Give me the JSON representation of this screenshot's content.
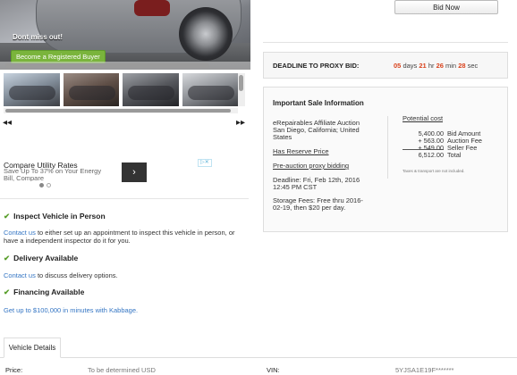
{
  "hero": {
    "headline": "Dont miss out!",
    "register_label": "Become a Registered Buyer"
  },
  "gallery": {
    "thumbnails": [
      "car-photo-1",
      "car-photo-2",
      "car-photo-3",
      "car-photo-4"
    ],
    "prev_icon": "◂◂",
    "next_icon": "▸▸"
  },
  "ad": {
    "title": "Compare Utility Rates",
    "subtitle": "Save Up To 37% on Your Energy Bill, Compare",
    "next_icon": "›",
    "close_icon": "▷✕"
  },
  "features": [
    {
      "title": "Inspect Vehicle in Person",
      "link": "Contact us",
      "text": " to either set up an appointment to inspect this vehicle in person, or have a independent inspector do it for you."
    },
    {
      "title": "Delivery Available",
      "link": "Contact us",
      "text": " to discuss delivery options."
    },
    {
      "title": "Financing Available",
      "link": "Get up to $100,000 in minutes with Kabbage.",
      "text": ""
    }
  ],
  "bid": {
    "button_label": "Bid Now"
  },
  "proxy": {
    "label": "DEADLINE TO PROXY BID:",
    "days": "05",
    "days_unit": "days",
    "hours": "21",
    "hours_unit": "hr",
    "minutes": "26",
    "minutes_unit": "min",
    "seconds": "28",
    "seconds_unit": "sec"
  },
  "info": {
    "title": "Important Sale Information",
    "seller_line1": "eRepairables Affiliate Auction",
    "seller_line2": "San Diego, California; United",
    "seller_line3": "States",
    "reserve": "Has Reserve Price",
    "pre_auction": "Pre-auction proxy bidding",
    "deadline_line1": "Deadline: Fri, Feb 12th, 2016",
    "deadline_line2": "12:45 PM CST",
    "storage_line1": "Storage Fees: Free thru 2016-",
    "storage_line2": "02-19, then $20 per day."
  },
  "cost": {
    "title": "Potential cost",
    "rows": [
      {
        "value": "5,400.00",
        "label": "Bid Amount"
      },
      {
        "value": "+ 563.00",
        "label": "Auction Fee"
      },
      {
        "value": "+ 549.00",
        "label": "Seller Fee"
      },
      {
        "value": "6,512.00",
        "label": "Total"
      }
    ],
    "note": "Taxes & transport are not included."
  },
  "details": {
    "tab_label": "Vehicle Details",
    "price_label": "Price:",
    "price_value": "To be determined USD",
    "vin_label": "VIN:",
    "vin_value": "5YJSA1E19F*******"
  }
}
